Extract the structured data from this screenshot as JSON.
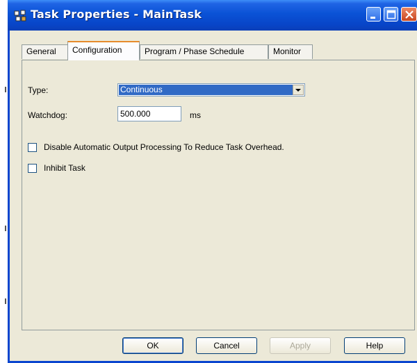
{
  "window": {
    "title": "Task Properties - MainTask"
  },
  "tabs": [
    {
      "label": "General",
      "active": false
    },
    {
      "label": "Configuration",
      "active": true
    },
    {
      "label": "Program / Phase Schedule",
      "active": false
    },
    {
      "label": "Monitor",
      "active": false
    }
  ],
  "form": {
    "type_label": "Type:",
    "type_value": "Continuous",
    "watchdog_label": "Watchdog:",
    "watchdog_value": "500.000",
    "watchdog_unit": "ms",
    "disable_output_label": "Disable Automatic Output Processing To Reduce Task Overhead.",
    "disable_output_checked": false,
    "inhibit_label": "Inhibit Task",
    "inhibit_checked": false
  },
  "buttons": {
    "ok": "OK",
    "cancel": "Cancel",
    "apply": "Apply",
    "help": "Help"
  },
  "colors": {
    "titlebar": "#0a52d6",
    "selection": "#316ac5",
    "active_tab_accent": "#e68b2c",
    "dialog_bg": "#ece9d8"
  },
  "icons": {
    "app": "task-properties-icon",
    "minimize": "minimize-icon",
    "maximize": "maximize-icon",
    "close": "close-icon",
    "dropdown": "chevron-down-icon"
  }
}
